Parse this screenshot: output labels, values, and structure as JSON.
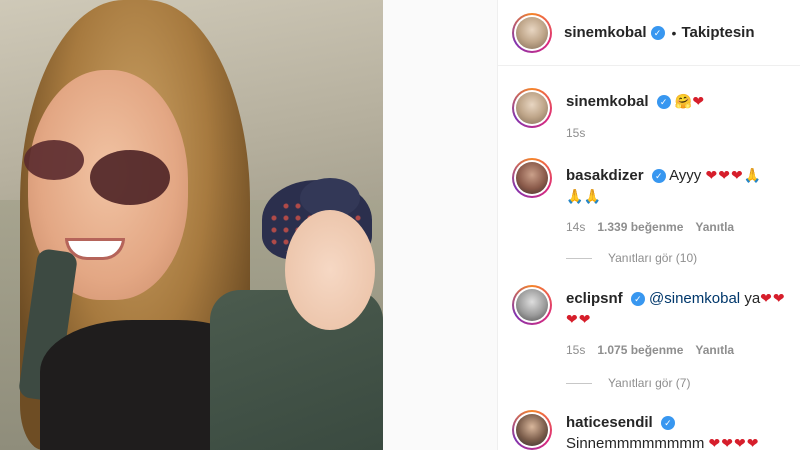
{
  "post": {
    "owner": "sinemkobal",
    "follow_status": "Takiptesin",
    "separator": "•"
  },
  "icons": {
    "verified": "verified-badge-icon",
    "heart": "red-heart-icon",
    "pray": "folded-hands-icon",
    "hug": "hugging-face-icon"
  },
  "glyphs": {
    "verified": "✓",
    "heart": "❤",
    "pray": "🙏",
    "hug": "🤗"
  },
  "colors": {
    "verified": "#3897f0",
    "heart": "#d61e2b",
    "meta_text": "#8e8e8e",
    "mention": "#00376b"
  },
  "comments": [
    {
      "user": "sinemkobal",
      "time": "15s"
    },
    {
      "user": "basakdizer",
      "text": "Ayyy",
      "time": "14s",
      "likes": "1.339 beğenme",
      "reply": "Yanıtla",
      "view_replies": "Yanıtları gör (10)"
    },
    {
      "user": "eclipsnf",
      "mention": "@sinemkobal",
      "text": "ya",
      "time": "15s",
      "likes": "1.075 beğenme",
      "reply": "Yanıtla",
      "view_replies": "Yanıtları gör (7)"
    },
    {
      "user": "haticesendil",
      "text": "Sinnemmmmmmmm"
    }
  ]
}
